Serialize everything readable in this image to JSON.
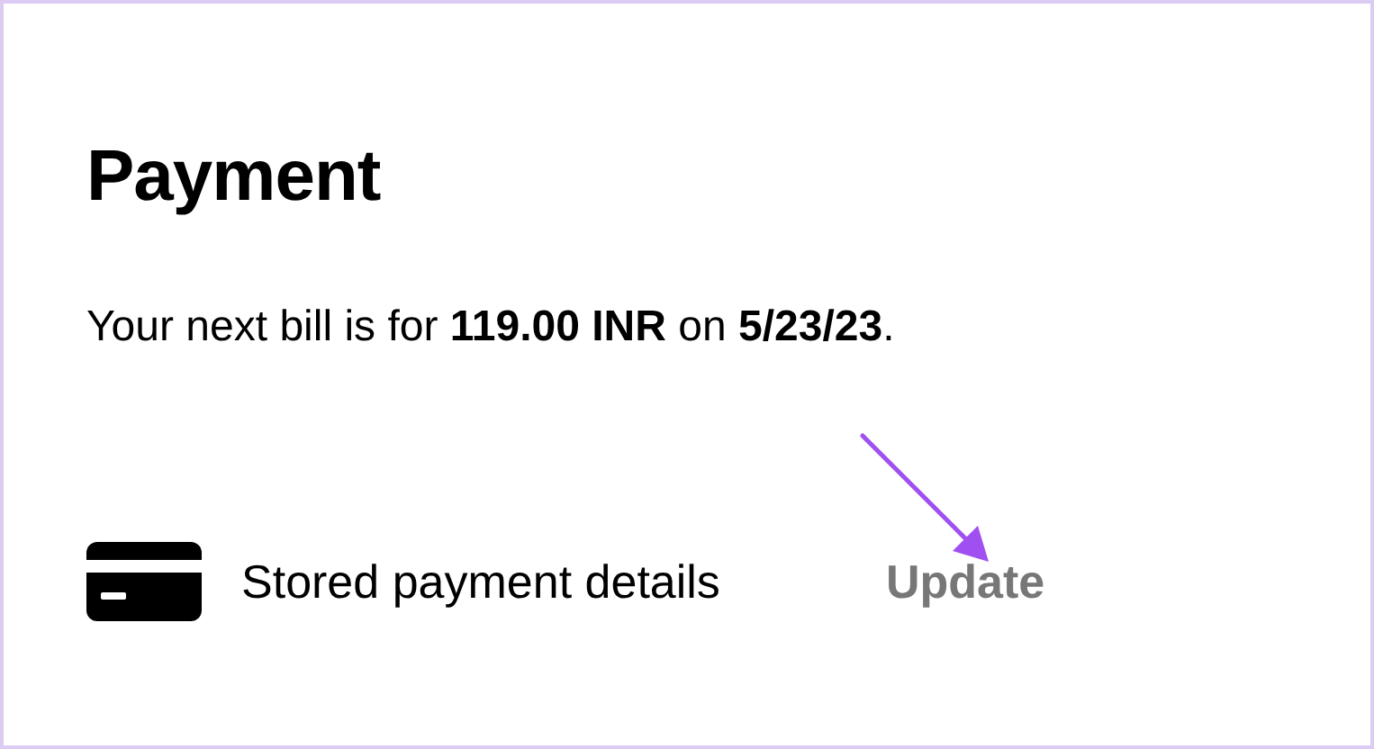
{
  "title": "Payment",
  "bill_text": "Your next bill is for **119.00 INR** on **5/23/23**.",
  "payment_method": {
    "label": "Stored payment details",
    "action": "Update"
  }
}
